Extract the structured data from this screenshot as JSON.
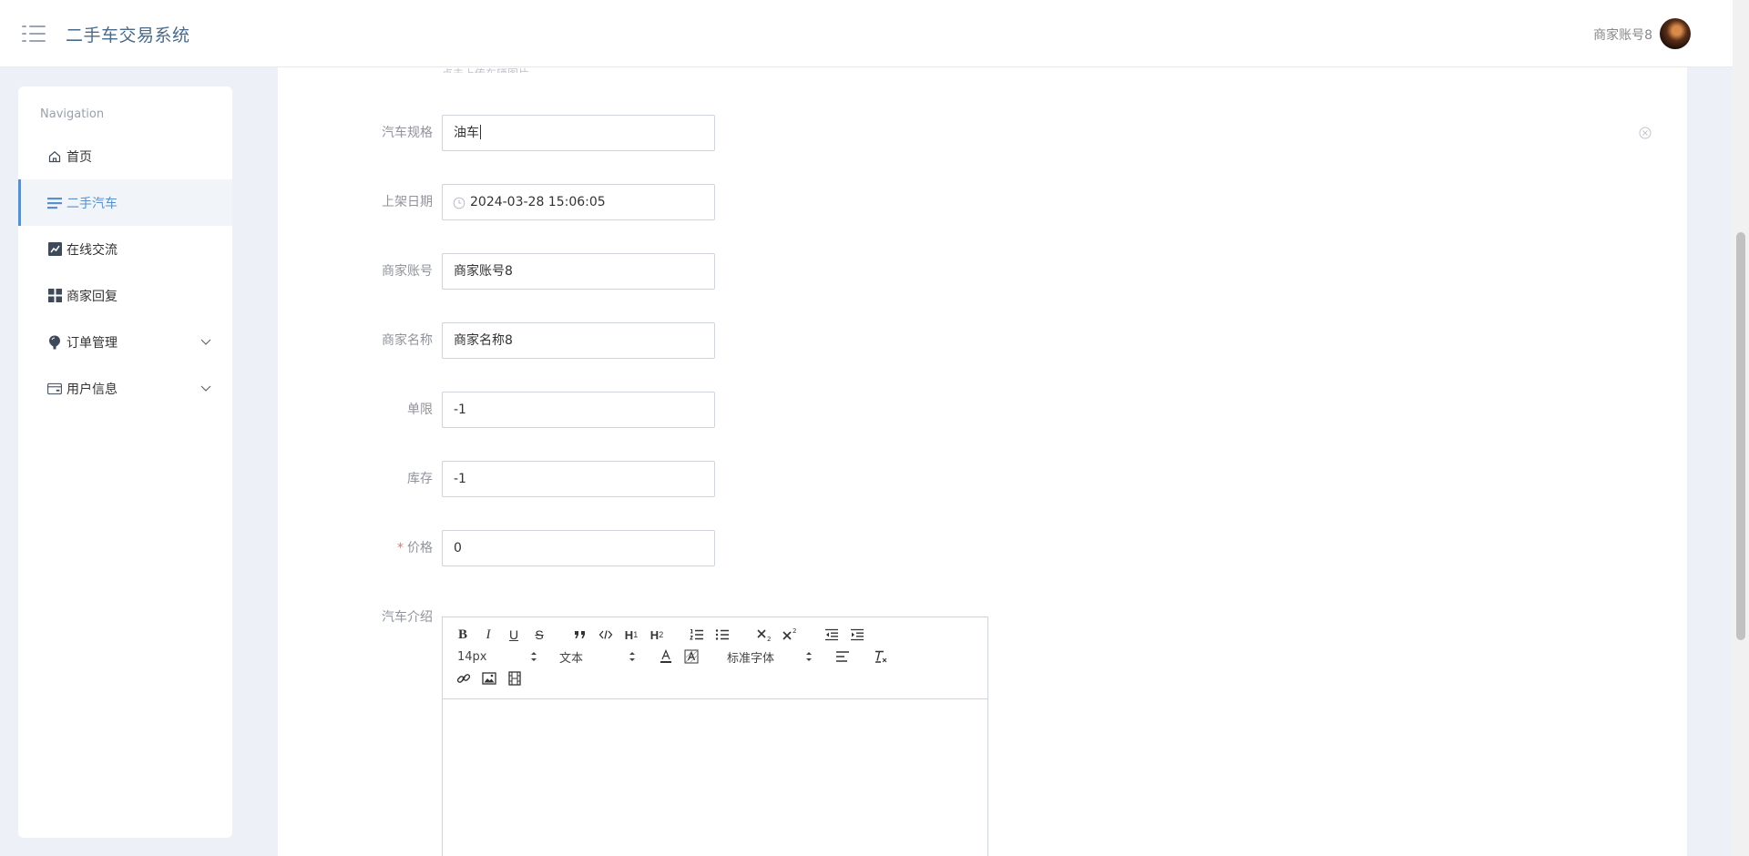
{
  "header": {
    "title": "二手车交易系统",
    "user_name": "商家账号8"
  },
  "sidebar": {
    "heading": "Navigation",
    "items": [
      {
        "label": "首页",
        "icon": "home-icon"
      },
      {
        "label": "二手汽车",
        "icon": "list-icon",
        "active": true
      },
      {
        "label": "在线交流",
        "icon": "chart-icon"
      },
      {
        "label": "商家回复",
        "icon": "grid-icon"
      },
      {
        "label": "订单管理",
        "icon": "pin-icon",
        "expandable": true
      },
      {
        "label": "用户信息",
        "icon": "card-icon",
        "expandable": true
      }
    ]
  },
  "form": {
    "tip_partial": "点击上传车辆图片",
    "fields": [
      {
        "label": "汽车规格",
        "value": "油车"
      },
      {
        "label": "上架日期",
        "value": "2024-03-28 15:06:05"
      },
      {
        "label": "商家账号",
        "value": "商家账号8"
      },
      {
        "label": "商家名称",
        "value": "商家名称8"
      },
      {
        "label": "单限",
        "value": "-1"
      },
      {
        "label": "库存",
        "value": "-1"
      },
      {
        "label": "价格",
        "value": "0",
        "required": true
      }
    ],
    "intro_label": "汽车介绍",
    "required_mark": "*"
  },
  "editor": {
    "font_size": "14px",
    "header_picker": "文本",
    "font_family": "标准字体",
    "h1": "H",
    "h1_sub": "1",
    "h2": "H",
    "h2_sub": "2",
    "bold": "B",
    "italic": "I",
    "underline": "U",
    "strike": "S"
  },
  "colors": {
    "accent": "#5b8fc7",
    "required": "#f56c6c",
    "background": "#eef0f7"
  }
}
